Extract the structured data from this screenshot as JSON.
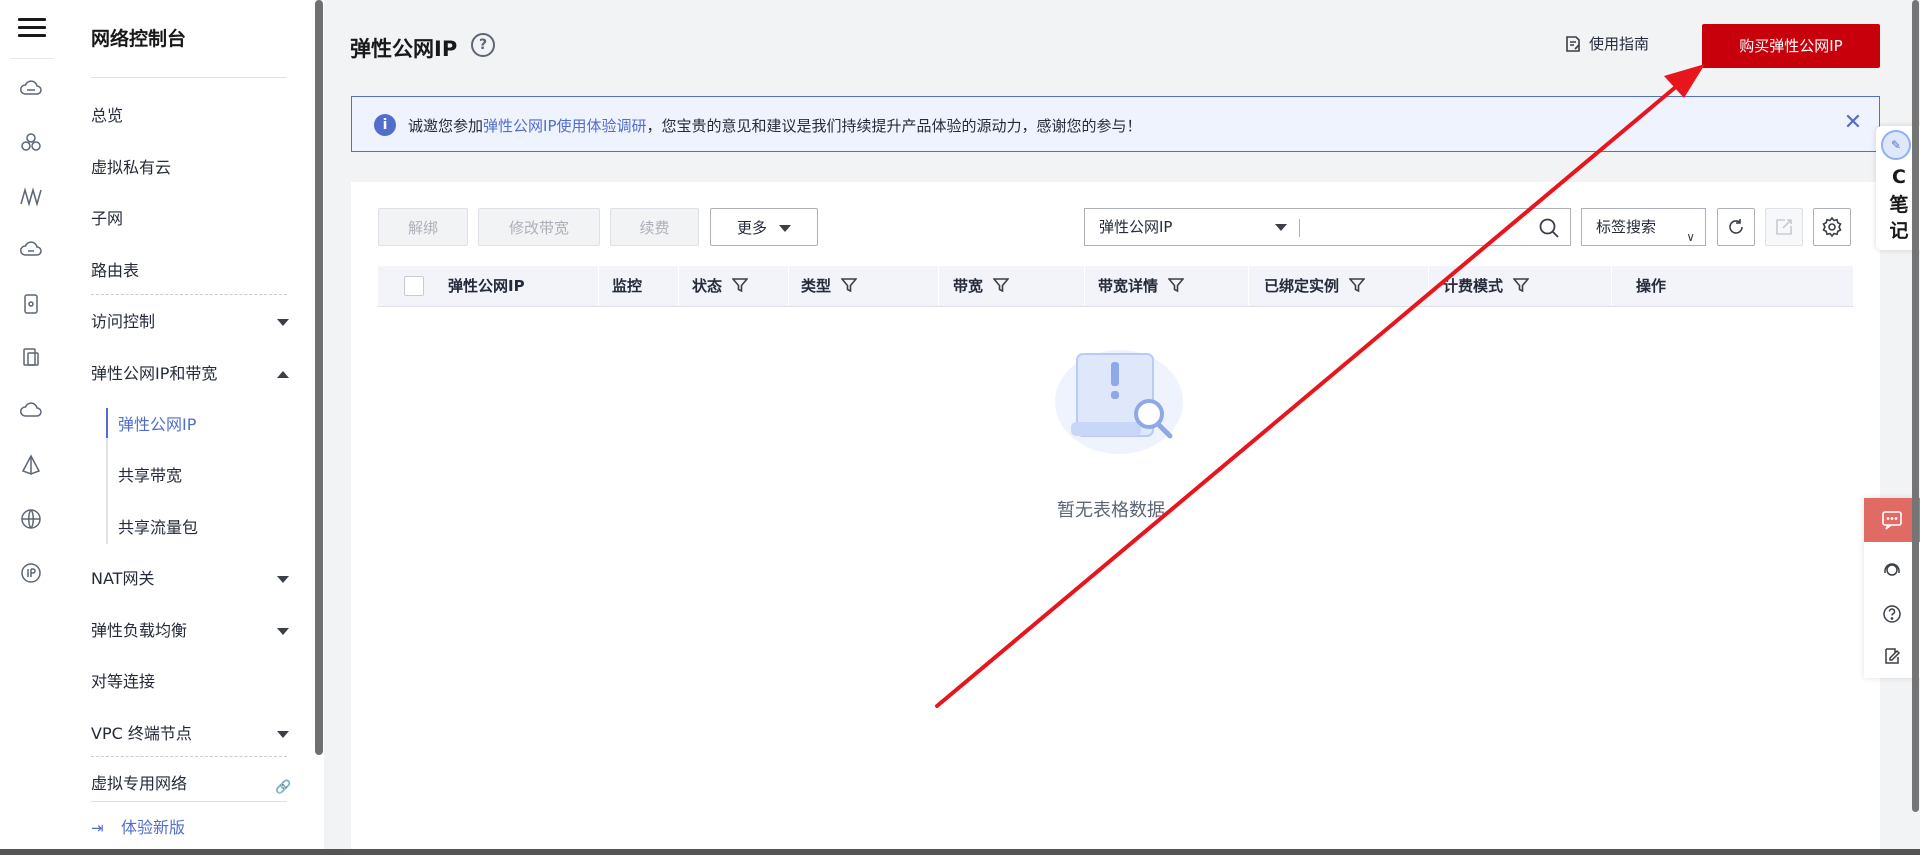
{
  "nav": {
    "title": "网络控制台",
    "items": [
      {
        "label": "总览"
      },
      {
        "label": "虚拟私有云"
      },
      {
        "label": "子网"
      },
      {
        "label": "路由表"
      },
      {
        "label": "访问控制"
      },
      {
        "label": "弹性公网IP和带宽"
      },
      {
        "label": "NAT网关"
      },
      {
        "label": "弹性负载均衡"
      },
      {
        "label": "对等连接"
      },
      {
        "label": "VPC 终端节点"
      },
      {
        "label": "虚拟专用网络"
      }
    ],
    "subitems": [
      {
        "label": "弹性公网IP"
      },
      {
        "label": "共享带宽"
      },
      {
        "label": "共享流量包"
      }
    ],
    "new_version": "体验新版"
  },
  "header": {
    "title": "弹性公网IP",
    "guide": "使用指南",
    "buy": "购买弹性公网IP"
  },
  "banner": {
    "prefix": "诚邀您参加",
    "link": "弹性公网IP使用体验调研",
    "suffix": "，您宝贵的意见和建议是我们持续提升产品体验的源动力，感谢您的参与！"
  },
  "toolbar": {
    "unbind": "解绑",
    "modify_bandwidth": "修改带宽",
    "renew": "续费",
    "more": "更多",
    "search_field": "弹性公网IP",
    "tag_search": "标签搜索"
  },
  "table": {
    "columns": [
      "弹性公网IP",
      "监控",
      "状态",
      "类型",
      "带宽",
      "带宽详情",
      "已绑定实例",
      "计费模式",
      "操作"
    ],
    "empty": "暂无表格数据"
  },
  "float": {
    "note_chars": [
      "C",
      "笔",
      "记"
    ]
  },
  "colors": {
    "primary": "#526ecc",
    "buy_button": "#c7000b",
    "annotation_arrow": "#e8161c"
  }
}
